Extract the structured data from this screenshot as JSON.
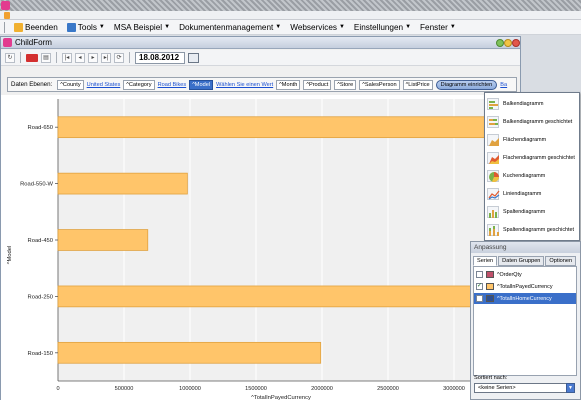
{
  "app": {
    "menu": [
      {
        "label": "Beenden",
        "icon": "exit-icon",
        "color": "#f0b030"
      },
      {
        "label": "Tools",
        "icon": "tools-icon",
        "color": "#3a78c8"
      },
      {
        "label": "MSA Beispiel",
        "icon": "",
        "color": ""
      },
      {
        "label": "Dokumentenmanagement",
        "icon": "",
        "color": ""
      },
      {
        "label": "Webservices",
        "icon": "",
        "color": ""
      },
      {
        "label": "Einstellungen",
        "icon": "",
        "color": ""
      },
      {
        "label": "Fenster",
        "icon": "",
        "color": ""
      }
    ]
  },
  "childform": {
    "title": "ChildForm",
    "toolbar": {
      "date": "18.08.2012"
    },
    "levels": {
      "label": "Daten Ebenen:",
      "chips": [
        {
          "text": "^County",
          "active": false
        },
        {
          "text": "United States",
          "link": true
        },
        {
          "text": "^Category",
          "active": false
        },
        {
          "text": "Road Bikes",
          "link": true
        },
        {
          "text": "^Model",
          "active": true
        },
        {
          "text": "Wählen Sie einen Wert",
          "link": true
        },
        {
          "text": "^Month",
          "active": false
        },
        {
          "text": "^Product",
          "active": false
        },
        {
          "text": "^Store",
          "active": false
        },
        {
          "text": "^SalesPerson",
          "active": false
        },
        {
          "text": "^ListPrice",
          "active": false
        }
      ],
      "pill": "Diagramm einrichten",
      "trailing_link": "Ba"
    }
  },
  "chart_data": {
    "type": "bar",
    "orientation": "horizontal",
    "categories": [
      "Road-650",
      "Road-550-W",
      "Road-450",
      "Road-250",
      "Road-150"
    ],
    "series": [
      {
        "name": "^TotalInPayedCurrency",
        "values": [
          3650000,
          980000,
          680000,
          3600000,
          1990000
        ],
        "color": "#ffc56a"
      }
    ],
    "xlabel": "^TotalInPayedCurrency",
    "ylabel": "^Model",
    "x_ticks": [
      "0",
      "500000",
      "1000000",
      "1500000",
      "2000000",
      "2500000",
      "3000000"
    ],
    "xlim": [
      0,
      3500000
    ],
    "grid": true,
    "legend_position": "bottom",
    "bar_color": "#ffc56a",
    "bar_border": "#e0a240"
  },
  "chart_type_menu": {
    "items": [
      {
        "label": "Balkendiagramm",
        "icon": "bar-chart-icon"
      },
      {
        "label": "Balkendiagramm geschichtet",
        "icon": "stacked-bar-chart-icon"
      },
      {
        "label": "Flächendiagramm",
        "icon": "area-chart-icon"
      },
      {
        "label": "Flachendiagramm geschichtet",
        "icon": "stacked-area-chart-icon"
      },
      {
        "label": "Kuchendiagramm",
        "icon": "pie-chart-icon"
      },
      {
        "label": "Liniendiagramm",
        "icon": "line-chart-icon"
      },
      {
        "label": "Spaltendiagramm",
        "icon": "column-chart-icon"
      },
      {
        "label": "Spaltendiagramm geschichtet",
        "icon": "stacked-column-chart-icon"
      }
    ]
  },
  "panel": {
    "title": "Anpassung",
    "tabs": [
      "Serien",
      "Daten Gruppen",
      "Optionen"
    ],
    "series": [
      {
        "label": "^OrderQty",
        "checked": false,
        "color": "#c0506a",
        "selected": false
      },
      {
        "label": "^TotalInPayedCurrency",
        "checked": true,
        "color": "#ffc56a",
        "selected": false
      },
      {
        "label": "^TotalInHomeCurrency",
        "checked": false,
        "color": "#2f4f8f",
        "selected": true
      }
    ],
    "sort_label": "Sortiert nach:",
    "sort_value": "<keine Serien>"
  }
}
